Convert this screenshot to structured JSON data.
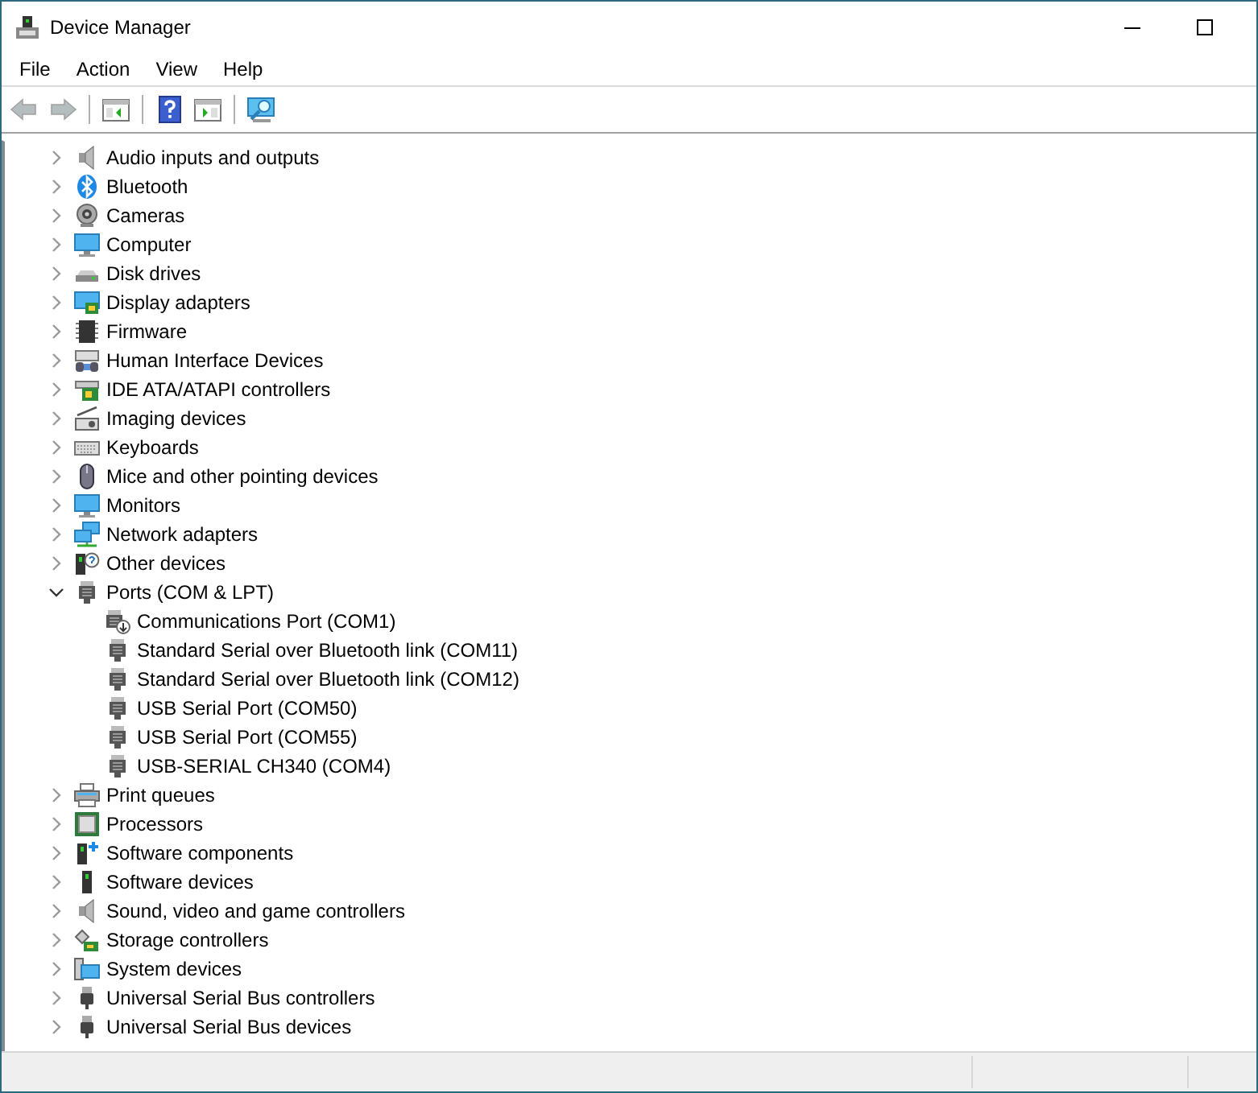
{
  "window": {
    "title": "Device Manager"
  },
  "menu": [
    "File",
    "Action",
    "View",
    "Help"
  ],
  "toolbar": [
    {
      "kind": "back",
      "disabled": true
    },
    {
      "kind": "forward",
      "disabled": true
    },
    {
      "kind": "sep"
    },
    {
      "kind": "console",
      "disabled": false
    },
    {
      "kind": "sep"
    },
    {
      "kind": "help",
      "disabled": false
    },
    {
      "kind": "pane",
      "disabled": false
    },
    {
      "kind": "sep"
    },
    {
      "kind": "scan",
      "disabled": false
    }
  ],
  "tree": {
    "items": [
      {
        "label": "Audio inputs and outputs",
        "kind": "speaker",
        "expanded": false
      },
      {
        "label": "Bluetooth",
        "kind": "bluetooth",
        "expanded": false
      },
      {
        "label": "Cameras",
        "kind": "camera",
        "expanded": false
      },
      {
        "label": "Computer",
        "kind": "monitor",
        "expanded": false
      },
      {
        "label": "Disk drives",
        "kind": "disk",
        "expanded": false
      },
      {
        "label": "Display adapters",
        "kind": "display",
        "expanded": false
      },
      {
        "label": "Firmware",
        "kind": "chip",
        "expanded": false
      },
      {
        "label": "Human Interface Devices",
        "kind": "hid",
        "expanded": false
      },
      {
        "label": "IDE ATA/ATAPI controllers",
        "kind": "ide",
        "expanded": false
      },
      {
        "label": "Imaging devices",
        "kind": "imaging",
        "expanded": false
      },
      {
        "label": "Keyboards",
        "kind": "keyboard",
        "expanded": false
      },
      {
        "label": "Mice and other pointing devices",
        "kind": "mouse",
        "expanded": false
      },
      {
        "label": "Monitors",
        "kind": "monitor",
        "expanded": false
      },
      {
        "label": "Network adapters",
        "kind": "network",
        "expanded": false
      },
      {
        "label": "Other devices",
        "kind": "other",
        "expanded": false
      },
      {
        "label": "Ports (COM & LPT)",
        "kind": "port",
        "expanded": true,
        "children": [
          {
            "label": "Communications Port (COM1)",
            "kind": "port-arrow"
          },
          {
            "label": "Standard Serial over Bluetooth link (COM11)",
            "kind": "port"
          },
          {
            "label": "Standard Serial over Bluetooth link (COM12)",
            "kind": "port"
          },
          {
            "label": "USB Serial Port (COM50)",
            "kind": "port"
          },
          {
            "label": "USB Serial Port (COM55)",
            "kind": "port"
          },
          {
            "label": "USB-SERIAL CH340 (COM4)",
            "kind": "port"
          }
        ]
      },
      {
        "label": "Print queues",
        "kind": "printer",
        "expanded": false
      },
      {
        "label": "Processors",
        "kind": "processor",
        "expanded": false
      },
      {
        "label": "Software components",
        "kind": "swcomp",
        "expanded": false
      },
      {
        "label": "Software devices",
        "kind": "swdev",
        "expanded": false
      },
      {
        "label": "Sound, video and game controllers",
        "kind": "speaker",
        "expanded": false
      },
      {
        "label": "Storage controllers",
        "kind": "storage",
        "expanded": false
      },
      {
        "label": "System devices",
        "kind": "system",
        "expanded": false
      },
      {
        "label": "Universal Serial Bus controllers",
        "kind": "usb",
        "expanded": false
      },
      {
        "label": "Universal Serial Bus devices",
        "kind": "usb",
        "expanded": false
      }
    ]
  }
}
